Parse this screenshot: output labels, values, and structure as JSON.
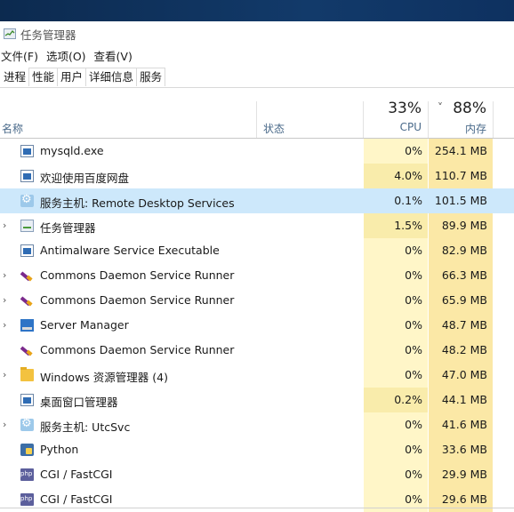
{
  "window": {
    "title": "任务管理器"
  },
  "menu": [
    "文件(F)",
    "选项(O)",
    "查看(V)"
  ],
  "tabs": [
    "进程",
    "性能",
    "用户",
    "详细信息",
    "服务"
  ],
  "header": {
    "name_label": "名称",
    "status_label": "状态",
    "cpu_pct": "33%",
    "cpu_label": "CPU",
    "mem_pct": "88%",
    "mem_label": "内存",
    "sort_indicator": "˅"
  },
  "processes": [
    {
      "name": "mysqld.exe",
      "cpu": "0%",
      "mem": "254.1 MB",
      "icon": "window-icon",
      "expandable": false,
      "selected": false
    },
    {
      "name": "欢迎使用百度网盘",
      "cpu": "4.0%",
      "mem": "110.7 MB",
      "icon": "window-icon",
      "expandable": false,
      "selected": false
    },
    {
      "name": "服务主机: Remote Desktop Services",
      "cpu": "0.1%",
      "mem": "101.5 MB",
      "icon": "gear-icon",
      "expandable": false,
      "selected": true
    },
    {
      "name": "任务管理器",
      "cpu": "1.5%",
      "mem": "89.9 MB",
      "icon": "task-manager-icon",
      "expandable": true,
      "selected": false
    },
    {
      "name": "Antimalware Service Executable",
      "cpu": "0%",
      "mem": "82.9 MB",
      "icon": "window-icon",
      "expandable": false,
      "selected": false
    },
    {
      "name": "Commons Daemon Service Runner",
      "cpu": "0%",
      "mem": "66.3 MB",
      "icon": "feather-icon",
      "expandable": true,
      "selected": false
    },
    {
      "name": "Commons Daemon Service Runner",
      "cpu": "0%",
      "mem": "65.9 MB",
      "icon": "feather-icon",
      "expandable": true,
      "selected": false
    },
    {
      "name": "Server Manager",
      "cpu": "0%",
      "mem": "48.7 MB",
      "icon": "server-icon",
      "expandable": true,
      "selected": false
    },
    {
      "name": "Commons Daemon Service Runner",
      "cpu": "0%",
      "mem": "48.2 MB",
      "icon": "feather-icon",
      "expandable": false,
      "selected": false
    },
    {
      "name": "Windows 资源管理器 (4)",
      "cpu": "0%",
      "mem": "47.0 MB",
      "icon": "folder-icon",
      "expandable": true,
      "selected": false
    },
    {
      "name": "桌面窗口管理器",
      "cpu": "0.2%",
      "mem": "44.1 MB",
      "icon": "window-icon",
      "expandable": false,
      "selected": false
    },
    {
      "name": "服务主机: UtcSvc",
      "cpu": "0%",
      "mem": "41.6 MB",
      "icon": "gear-icon",
      "expandable": true,
      "selected": false
    },
    {
      "name": "Python",
      "cpu": "0%",
      "mem": "33.6 MB",
      "icon": "python-icon",
      "expandable": false,
      "selected": false
    },
    {
      "name": "CGI / FastCGI",
      "cpu": "0%",
      "mem": "29.9 MB",
      "icon": "php-icon",
      "expandable": false,
      "selected": false
    },
    {
      "name": "CGI / FastCGI",
      "cpu": "0%",
      "mem": "29.6 MB",
      "icon": "php-icon",
      "expandable": false,
      "selected": false
    }
  ],
  "colors": {
    "cpu_bg": "#fff6c8",
    "mem_bg": "#fbe8a6",
    "selected_bg": "#cde8fb"
  }
}
